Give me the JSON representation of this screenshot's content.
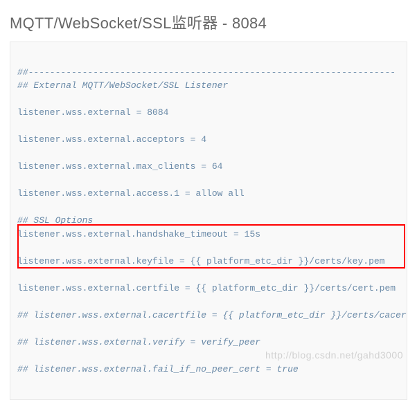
{
  "heading": "MQTT/WebSocket/SSL监听器 - 8084",
  "code": {
    "line1": "##--------------------------------------------------------------------",
    "line2": "## External MQTT/WebSocket/SSL Listener",
    "line3": "",
    "line4": "listener.wss.external = 8084",
    "line5": "",
    "line6": "listener.wss.external.acceptors = 4",
    "line7": "",
    "line8": "listener.wss.external.max_clients = 64",
    "line9": "",
    "line10": "listener.wss.external.access.1 = allow all",
    "line11": "",
    "line12": "## SSL Options",
    "line13": "listener.wss.external.handshake_timeout = 15s",
    "line14": "",
    "line15": "listener.wss.external.keyfile = {{ platform_etc_dir }}/certs/key.pem",
    "line16": "",
    "line17": "listener.wss.external.certfile = {{ platform_etc_dir }}/certs/cert.pem",
    "line18": "",
    "line19": "## listener.wss.external.cacertfile = {{ platform_etc_dir }}/certs/cacert.pem",
    "line20": "",
    "line21": "## listener.wss.external.verify = verify_peer",
    "line22": "",
    "line23": "## listener.wss.external.fail_if_no_peer_cert = true"
  },
  "watermark": "http://blog.csdn.net/gahd3000"
}
